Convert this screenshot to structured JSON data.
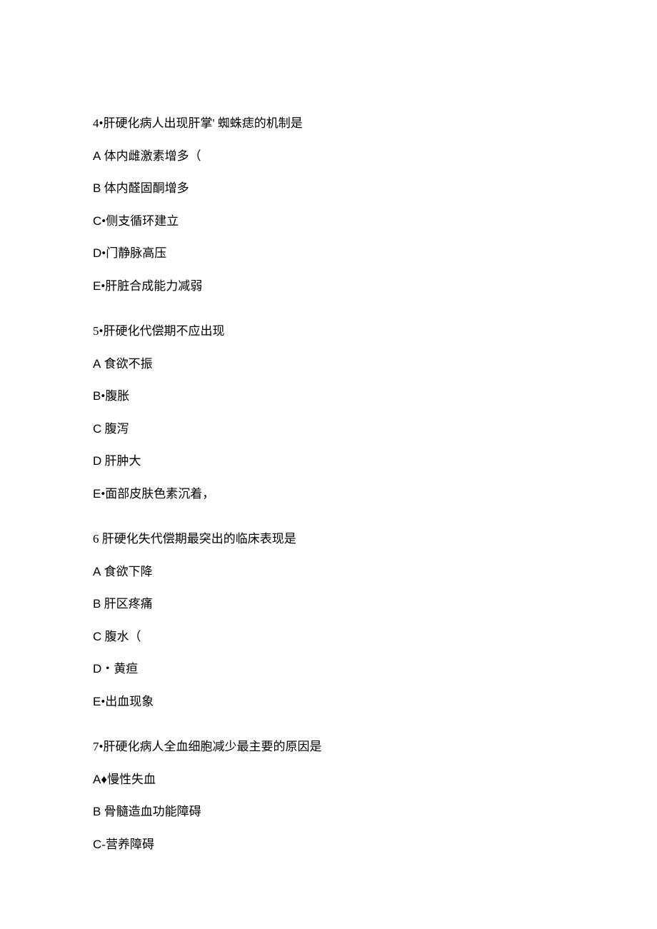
{
  "questions": [
    {
      "stem": "4•肝硬化病人出现肝掌' 蜘蛛痣的机制是",
      "options": [
        {
          "letter": "A",
          "sep": " ",
          "text": "体内雌激素增多（"
        },
        {
          "letter": "B",
          "sep": " ",
          "text": "体内醛固酮增多"
        },
        {
          "letter": "C",
          "sep": "•",
          "text": "侧支循环建立"
        },
        {
          "letter": "D",
          "sep": "•",
          "text": "门静脉高压"
        },
        {
          "letter": "E",
          "sep": "•",
          "text": "肝脏合成能力减弱"
        }
      ]
    },
    {
      "stem": "5•肝硬化代偿期不应出现",
      "options": [
        {
          "letter": "A",
          "sep": " ",
          "text": "食欲不振"
        },
        {
          "letter": "B",
          "sep": "•",
          "text": "腹胀"
        },
        {
          "letter": "C",
          "sep": " ",
          "text": "腹泻"
        },
        {
          "letter": "D",
          "sep": " ",
          "text": "肝肿大"
        },
        {
          "letter": "E",
          "sep": "•",
          "text": "面部皮肤色素沉着，"
        }
      ]
    },
    {
      "stem": "6 肝硬化失代偿期最突出的临床表现是",
      "options": [
        {
          "letter": "A",
          "sep": " ",
          "text": "食欲下降"
        },
        {
          "letter": "B",
          "sep": " ",
          "text": "肝区疼痛"
        },
        {
          "letter": "C",
          "sep": " ",
          "text": "腹水（"
        },
        {
          "letter": "D",
          "sep": "・",
          "text": "黄疸"
        },
        {
          "letter": "E",
          "sep": "•",
          "text": "出血现象"
        }
      ]
    },
    {
      "stem": "7•肝硬化病人全血细胞减少最主要的原因是",
      "options": [
        {
          "letter": "A",
          "sep": "♦",
          "text": "慢性失血"
        },
        {
          "letter": "B",
          "sep": " ",
          "text": "骨髓造血功能障碍"
        },
        {
          "letter": "C",
          "sep": "-",
          "text": "营养障碍"
        }
      ]
    }
  ]
}
